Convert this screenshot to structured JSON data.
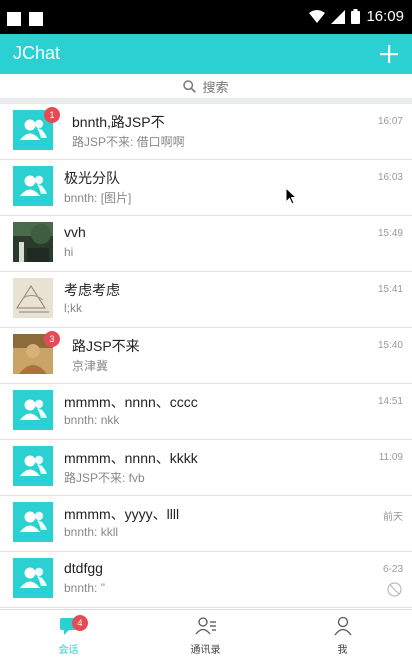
{
  "status_bar": {
    "time": "16:09"
  },
  "app_bar": {
    "title": "JChat"
  },
  "search": {
    "placeholder": "搜索"
  },
  "conversations": [
    {
      "name": "bnnth,路JSP不",
      "message": "路JSP不来: 借口啊啊",
      "time": "16:07",
      "badge": "1",
      "avatar": "default"
    },
    {
      "name": "极光分队",
      "message": "bnnth: [图片]",
      "time": "16:03",
      "avatar": "default"
    },
    {
      "name": "vvh",
      "message": "hi",
      "time": "15:49",
      "avatar": "photo-dark"
    },
    {
      "name": "考虑考虑",
      "message": "l;kk",
      "time": "15:41",
      "avatar": "photo-sketch"
    },
    {
      "name": "路JSP不来",
      "message": "京津冀",
      "time": "15:40",
      "badge": "3",
      "avatar": "photo-person"
    },
    {
      "name": "mmmm、nnnn、cccc",
      "message": "bnnth: nkk",
      "time": "14:51",
      "avatar": "default"
    },
    {
      "name": "mmmm、nnnn、kkkk",
      "message": "路JSP不来: fvb",
      "time": "11:09",
      "avatar": "default"
    },
    {
      "name": "mmmm、yyyy、llll",
      "message": "bnnth: kkll",
      "time": "前天",
      "avatar": "default"
    },
    {
      "name": "dtdfgg",
      "message": "bnnth: \"",
      "time": "6-23",
      "avatar": "default",
      "no_disturb": true
    }
  ],
  "bottom_nav": {
    "tabs": [
      {
        "label": "会话",
        "badge": "4",
        "active": true
      },
      {
        "label": "通讯录"
      },
      {
        "label": "我"
      }
    ]
  },
  "colors": {
    "accent": "#2ad0d2",
    "badge": "#e84a55"
  }
}
